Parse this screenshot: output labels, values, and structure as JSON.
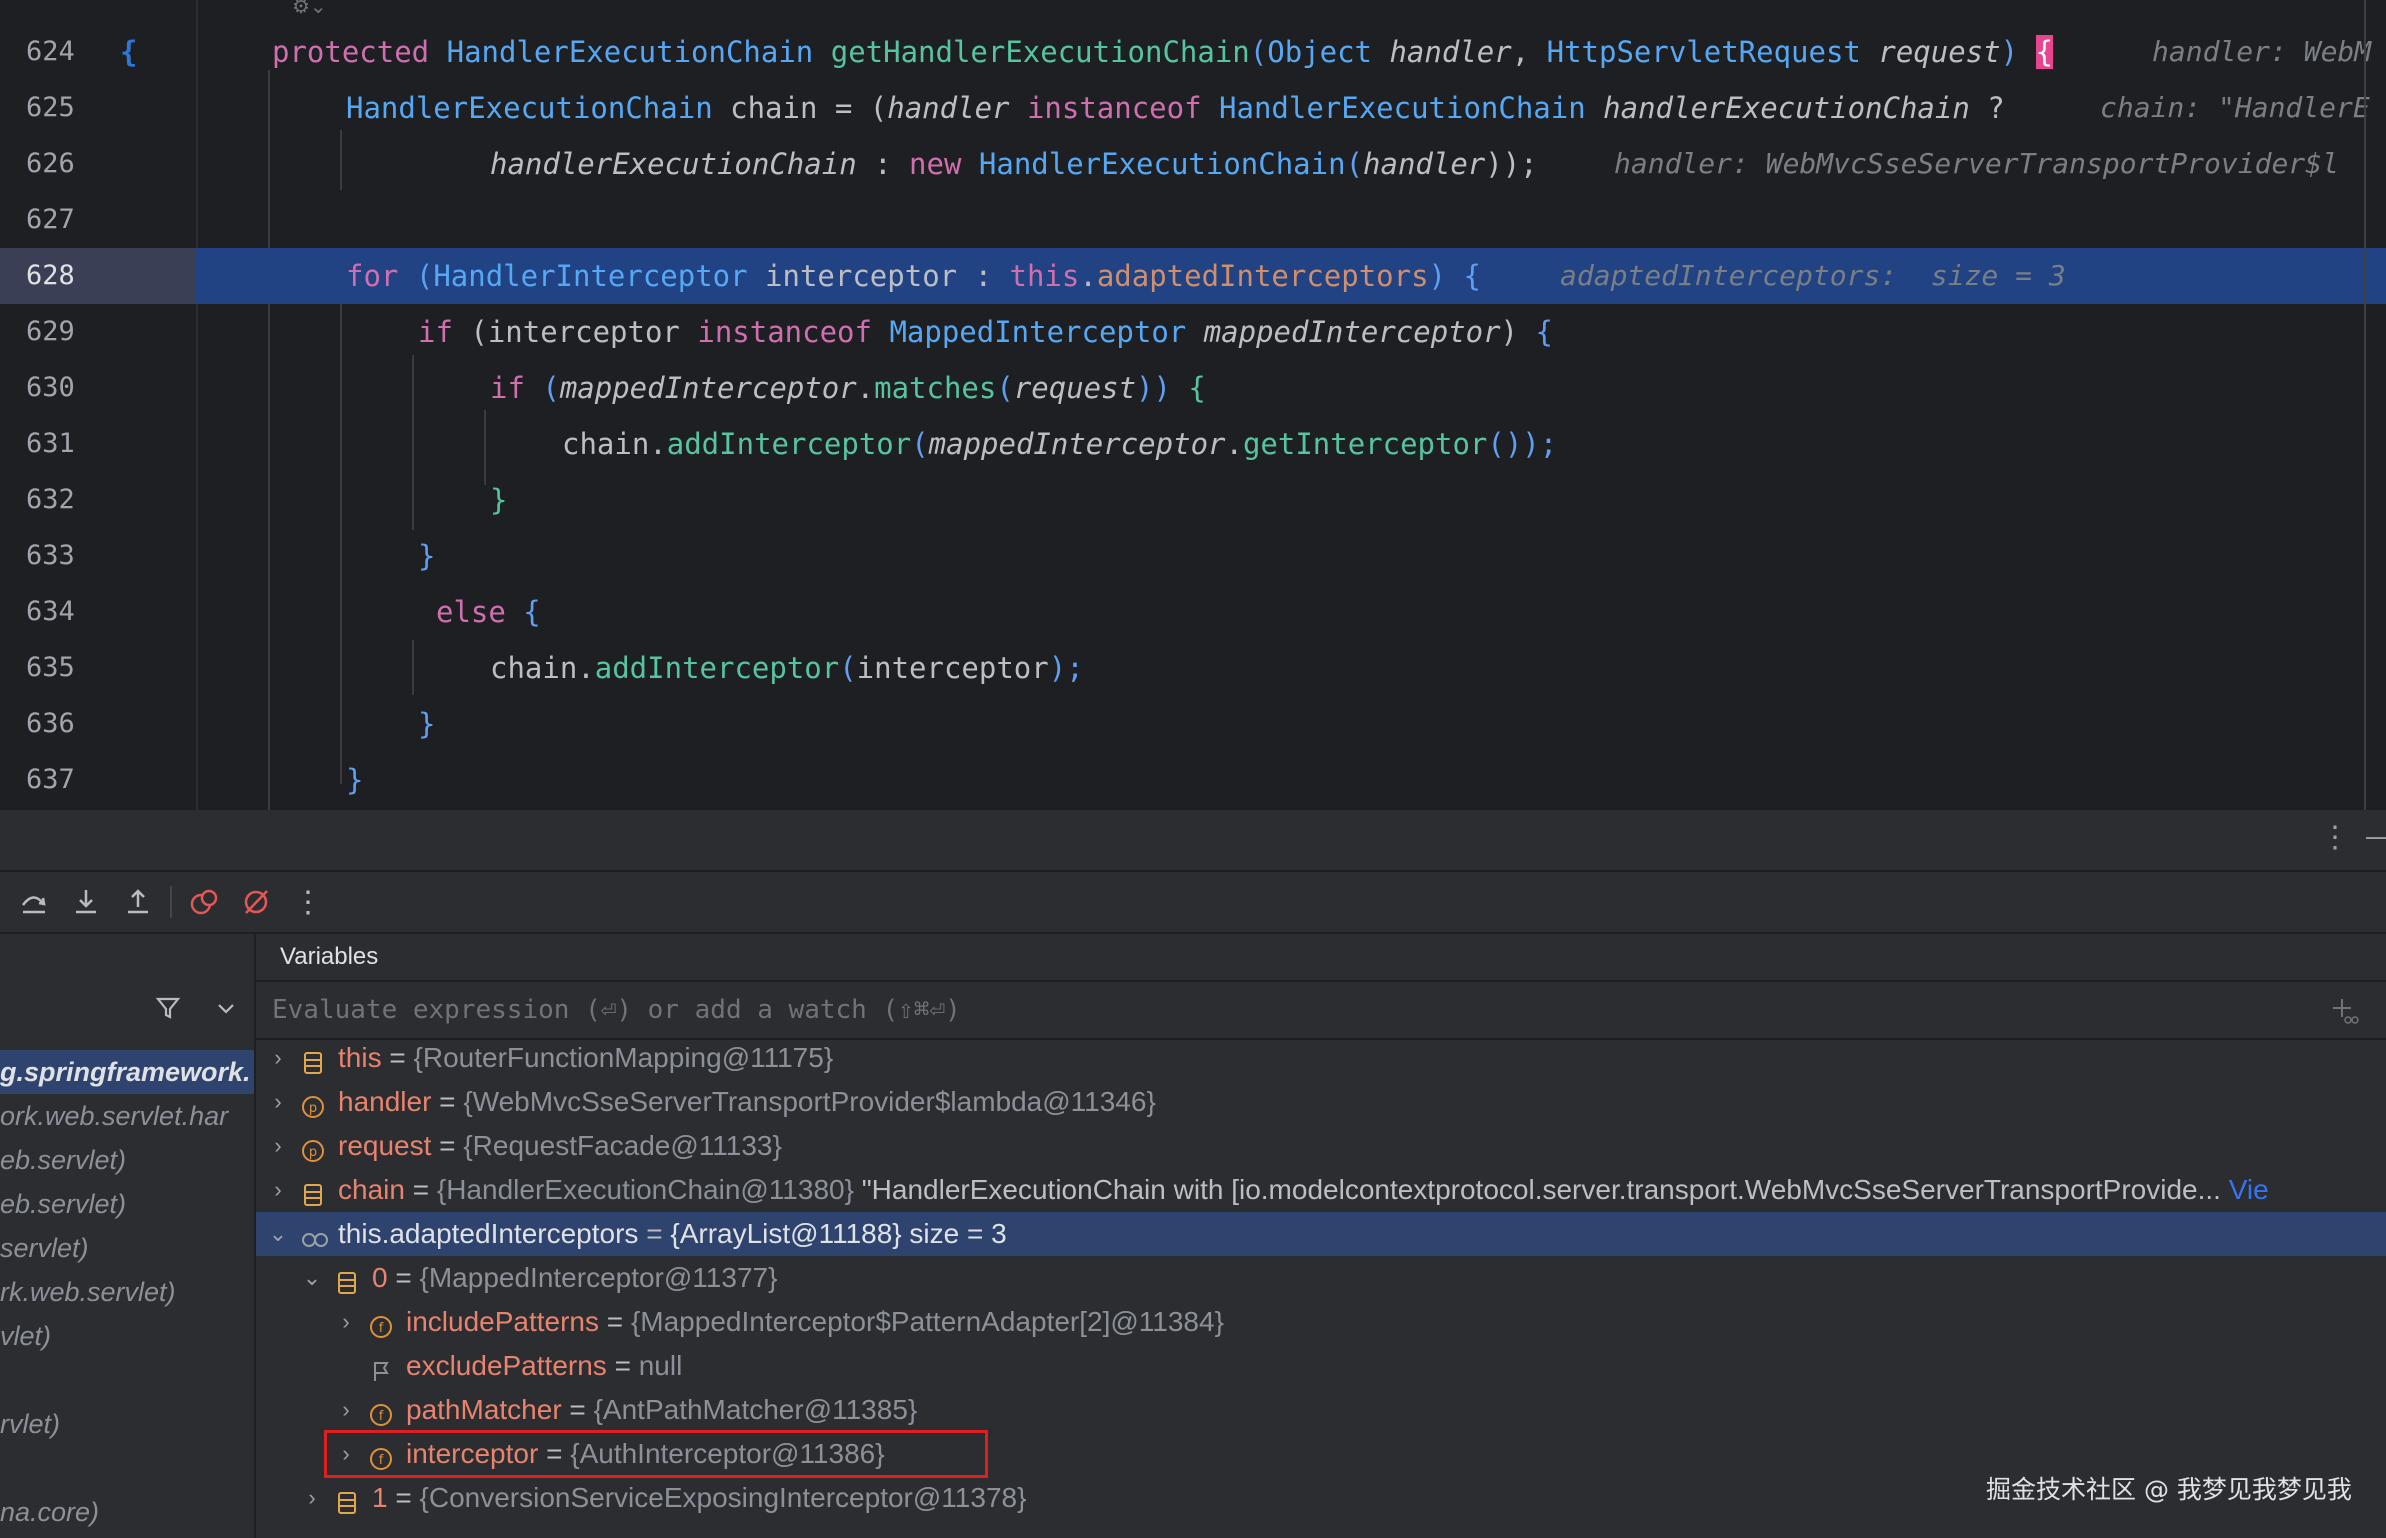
{
  "colors": {
    "editor_bg": "#1e1f22",
    "current_line": "#214283",
    "keyword": "#cf6fb0",
    "type": "#56a8f5",
    "method": "#57c4a0",
    "hint": "#7a7e85",
    "selection": "#2e436e",
    "highlight_box": "#e02020"
  },
  "editor": {
    "current_line": "628",
    "lines": [
      {
        "n": "624",
        "kw1": "protected",
        "t1": "HandlerExecutionChain",
        "m1": "getHandlerExecutionChain",
        "p1": "(",
        "t2": "Object",
        "v1": "handler",
        "s1": ", ",
        "t3": "HttpServletRequest",
        "v2": "request",
        "p2": ")",
        "ob": "{",
        "hint": "handler: WebM"
      },
      {
        "n": "625",
        "t1": "HandlerExecutionChain",
        "a1": " chain = (",
        "v1": "handler",
        "kw1": "instanceof",
        "t2": "HandlerExecutionChain",
        "v2": "handlerExecutionChain",
        "q": " ?",
        "hint": "chain: \"HandlerE"
      },
      {
        "n": "626",
        "v1": "handlerExecutionChain",
        "a1": " : ",
        "kw1": "new",
        "t1": "HandlerExecutionChain",
        "p1": "(",
        "v2": "handler",
        "p2": "));",
        "hint": "handler: WebMvcSseServerTransportProvider$l"
      },
      {
        "n": "627"
      },
      {
        "n": "628",
        "kw1": "for",
        "p1": " (",
        "t1": "HandlerInterceptor",
        "a1": " interceptor : ",
        "th": "this",
        "dot": ".",
        "fd": "adaptedInterceptors",
        "p2": ")",
        "ob": " {",
        "hint": "adaptedInterceptors:  size = 3"
      },
      {
        "n": "629",
        "kw1": "if",
        "p1": " (interceptor ",
        "kw2": "instanceof",
        "t1": "MappedInterceptor",
        "v1": "mappedInterceptor",
        "p2": ")",
        "ob": " {"
      },
      {
        "n": "630",
        "kw1": "if",
        "p1": " (",
        "v1": "mappedInterceptor",
        "dot": ".",
        "m1": "matches",
        "p2": "(",
        "v2": "request",
        "p3": "))",
        "ob": " {"
      },
      {
        "n": "631",
        "a1": "chain.",
        "m1": "addInterceptor",
        "p1": "(",
        "v1": "mappedInterceptor",
        "dot": ".",
        "m2": "getInterceptor",
        "p2": "());"
      },
      {
        "n": "632",
        "cb": "}"
      },
      {
        "n": "633",
        "cb": "}"
      },
      {
        "n": "634",
        "kw1": "else",
        "ob": " {"
      },
      {
        "n": "635",
        "a1": "chain.",
        "m1": "addInterceptor",
        "p1": "(",
        "a2": "interceptor",
        "p2": ");"
      },
      {
        "n": "636",
        "cb": "}"
      },
      {
        "n": "637",
        "cb": "}"
      }
    ]
  },
  "debugger": {
    "header_menu": "⋮",
    "header_min": "—",
    "toolbar": [
      {
        "name": "step-over-icon",
        "glyph": "⤼"
      },
      {
        "name": "step-into-icon",
        "glyph": "⤓"
      },
      {
        "name": "step-out-icon",
        "glyph": "⤒"
      },
      {
        "name": "view-breakpoints-icon",
        "glyph": "◯"
      },
      {
        "name": "mute-breakpoints-icon",
        "glyph": "⊘"
      },
      {
        "name": "more-icon",
        "glyph": "⋮"
      }
    ],
    "frames": [
      "g.springframework.",
      "ork.web.servlet.har",
      "eb.servlet)",
      "eb.servlet)",
      "servlet)",
      "rk.web.servlet)",
      "vlet)",
      "",
      "rvlet)",
      "",
      "na.core)"
    ],
    "variables_title": "Variables",
    "eval_placeholder": "Evaluate expression (⏎) or add a watch (⇧⌘⏎)",
    "vars": [
      {
        "indent": 0,
        "chev": "›",
        "icon": "local",
        "name": "this",
        "eq": " = ",
        "val": "{RouterFunctionMapping@11175}"
      },
      {
        "indent": 0,
        "chev": "›",
        "icon": "param",
        "name": "handler",
        "eq": " = ",
        "val": "{WebMvcSseServerTransportProvider$lambda@11346}"
      },
      {
        "indent": 0,
        "chev": "›",
        "icon": "param",
        "name": "request",
        "eq": " = ",
        "val": "{RequestFacade@11133}"
      },
      {
        "indent": 0,
        "chev": "›",
        "icon": "local",
        "name": "chain",
        "eq": " = ",
        "val": "{HandlerExecutionChain@11380}",
        "str": " \"HandlerExecutionChain with [io.modelcontextprotocol.server.transport.WebMvcSseServerTransportProvide...",
        "link": " Vie"
      },
      {
        "indent": 0,
        "chev": "⌄",
        "icon": "watch",
        "name": "this.adaptedInterceptors",
        "eq": " = ",
        "val": "{ArrayList@11188}  size = 3",
        "selected": true
      },
      {
        "indent": 1,
        "chev": "⌄",
        "icon": "local",
        "name": "0",
        "eq": " = ",
        "val": "{MappedInterceptor@11377}"
      },
      {
        "indent": 2,
        "chev": "›",
        "icon": "field",
        "name": "includePatterns",
        "eq": " = ",
        "val": "{MappedInterceptor$PatternAdapter[2]@11384}"
      },
      {
        "indent": 2,
        "chev": "",
        "icon": "flag",
        "name": "excludePatterns",
        "eq": " = ",
        "val": "null"
      },
      {
        "indent": 2,
        "chev": "›",
        "icon": "field",
        "name": "pathMatcher",
        "eq": " = ",
        "val": "{AntPathMatcher@11385}"
      },
      {
        "indent": 2,
        "chev": "›",
        "icon": "field",
        "name": "interceptor",
        "eq": " = ",
        "val": "{AuthInterceptor@11386}",
        "boxed": true
      },
      {
        "indent": 1,
        "chev": "›",
        "icon": "local",
        "name": "1",
        "eq": " = ",
        "val": "{ConversionServiceExposingInterceptor@11378}"
      }
    ]
  },
  "watermark": "掘金技术社区 @ 我梦见我梦见我"
}
